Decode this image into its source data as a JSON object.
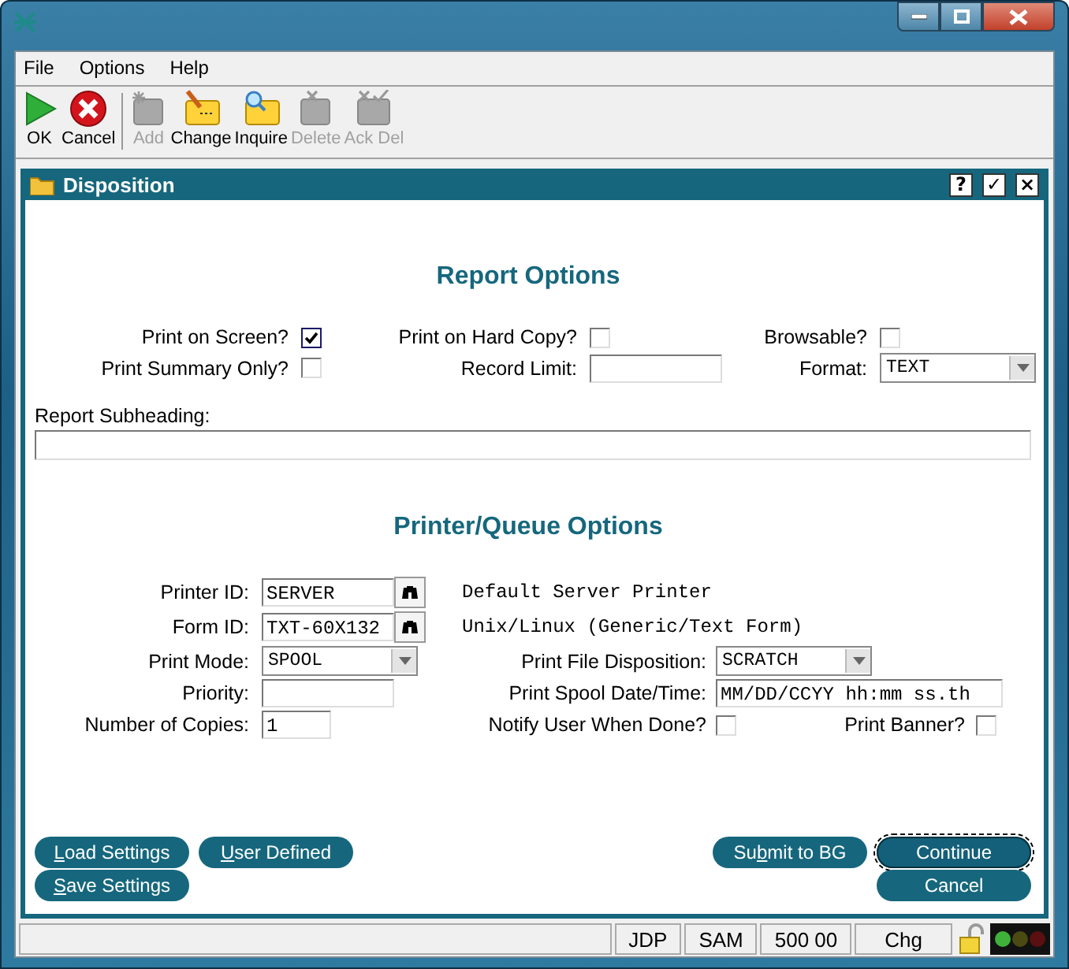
{
  "menu": [
    "File",
    "Options",
    "Help"
  ],
  "toolbar": [
    {
      "label": "OK",
      "disabled": false
    },
    {
      "label": "Cancel",
      "disabled": false
    },
    {
      "label": "Add",
      "disabled": true
    },
    {
      "label": "Change",
      "disabled": false
    },
    {
      "label": "Inquire",
      "disabled": false
    },
    {
      "label": "Delete",
      "disabled": true
    },
    {
      "label": "Ack Del",
      "disabled": true
    }
  ],
  "panel": {
    "title": "Disposition",
    "controls": [
      "?",
      "✓",
      "×"
    ]
  },
  "report_options": {
    "heading": "Report Options",
    "print_on_screen": {
      "label": "Print on Screen?",
      "checked": true
    },
    "print_on_hard_copy": {
      "label": "Print on Hard Copy?",
      "checked": false
    },
    "browsable": {
      "label": "Browsable?",
      "checked": false
    },
    "print_summary_only": {
      "label": "Print Summary Only?",
      "checked": false
    },
    "record_limit": {
      "label": "Record Limit:"
    },
    "format": {
      "label": "Format:",
      "value": "TEXT"
    },
    "report_subheading": {
      "label": "Report Subheading:"
    }
  },
  "printer_options": {
    "heading": "Printer/Queue Options",
    "printer_id": {
      "label": "Printer ID:",
      "value": "SERVER",
      "description": "Default Server Printer"
    },
    "form_id": {
      "label": "Form ID:",
      "value": "TXT-60X132",
      "description": "Unix/Linux (Generic/Text Form)"
    },
    "print_mode": {
      "label": "Print Mode:",
      "value": "SPOOL"
    },
    "print_file_disposition": {
      "label": "Print File Disposition:",
      "value": "SCRATCH"
    },
    "priority": {
      "label": "Priority:"
    },
    "print_spool_date_time": {
      "label": "Print Spool Date/Time:",
      "value": "MM/DD/CCYY hh:mm ss.th"
    },
    "number_of_copies": {
      "label": "Number of Copies:",
      "value": "1"
    },
    "notify_user_when_done": {
      "label": "Notify User When Done?",
      "checked": false
    },
    "print_banner": {
      "label": "Print Banner?",
      "checked": false
    }
  },
  "buttons_left": [
    [
      {
        "key": "L",
        "post": "oad Settings"
      },
      {
        "key": "U",
        "post": "ser Defined"
      }
    ],
    [
      {
        "key": "S",
        "post": "ave Settings"
      }
    ]
  ],
  "buttons_right": [
    {
      "pre": "Su",
      "key": "b",
      "post": "mit to BG",
      "focused": false
    },
    {
      "pre": "Continue",
      "focused": true
    },
    {
      "pre": "Cancel",
      "focused": false
    }
  ],
  "status_bar": [
    "JDP",
    "SAM",
    "500 00",
    "Chg"
  ]
}
